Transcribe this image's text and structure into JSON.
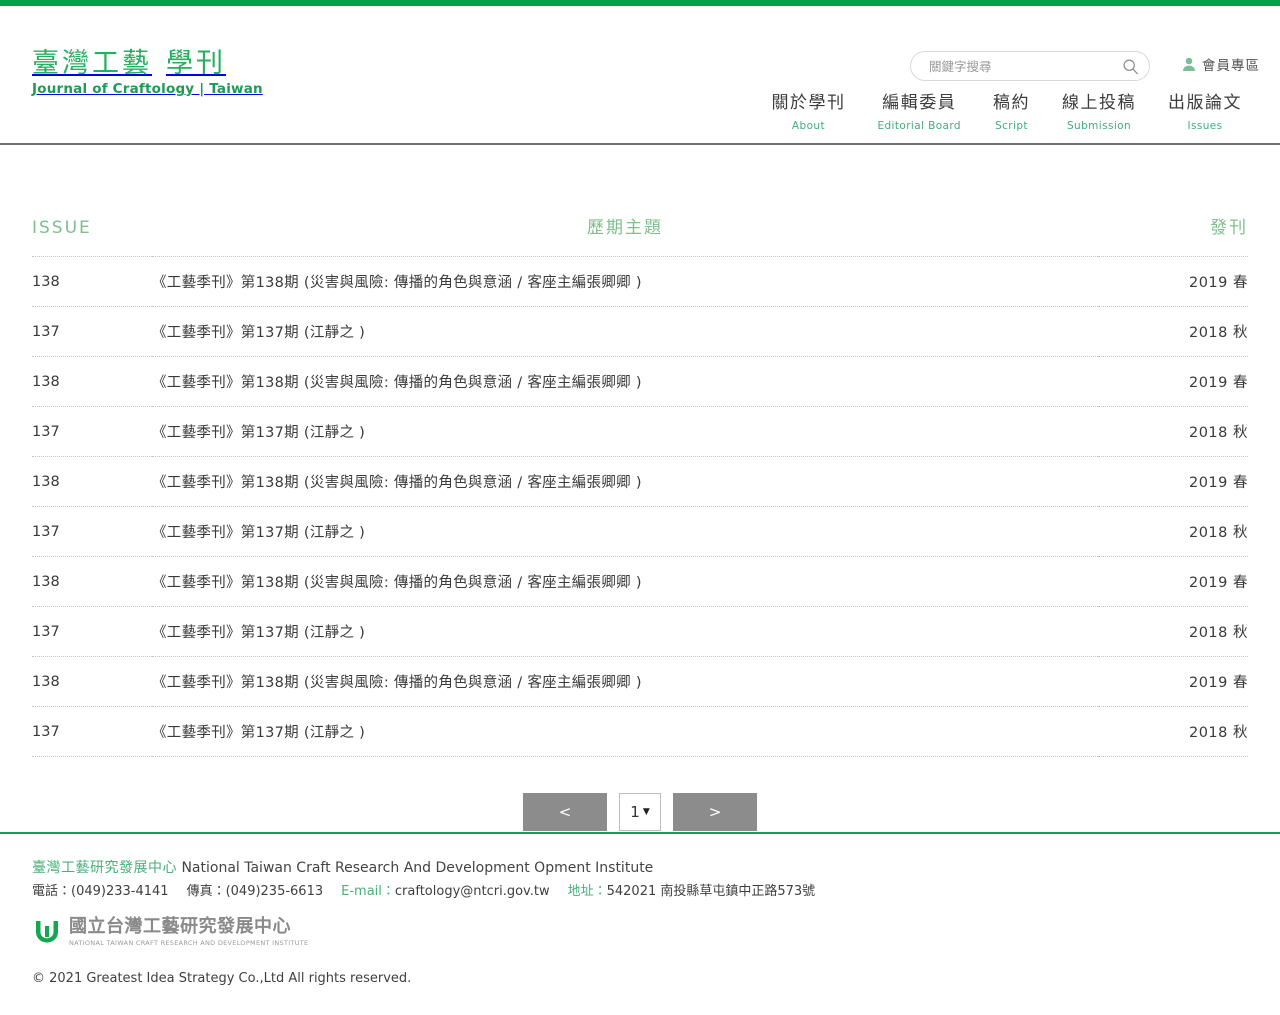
{
  "brand": {
    "logo_cn_part1": "臺灣工藝",
    "logo_cn_part2": "學刊",
    "logo_en": "Journal of Craftology  |  Taiwan",
    "accent_green": "#00a14b",
    "logo_green": "#27ae60"
  },
  "header": {
    "search": {
      "placeholder": "關鍵字搜尋",
      "value": "",
      "icon": "search-icon"
    },
    "member": {
      "label": "會員專區",
      "icon": "user-icon"
    },
    "nav": [
      {
        "cn": "關於學刊",
        "en": "About"
      },
      {
        "cn": "編輯委員",
        "en": "Editorial Board"
      },
      {
        "cn": "稿約",
        "en": "Script"
      },
      {
        "cn": "線上投稿",
        "en": "Submission"
      },
      {
        "cn": "出版論文",
        "en": "Issues"
      }
    ]
  },
  "table": {
    "columns": [
      "ISSUE",
      "歷期主題",
      "發刊"
    ],
    "rows": [
      {
        "issue": "138",
        "topic": "《工藝季刊》第138期 (災害與風險: 傳播的角色與意涵 / 客座主編張卿卿 )",
        "date": "2019 春"
      },
      {
        "issue": "137",
        "topic": "《工藝季刊》第137期 (江靜之 )",
        "date": "2018 秋"
      },
      {
        "issue": "138",
        "topic": "《工藝季刊》第138期 (災害與風險: 傳播的角色與意涵 / 客座主編張卿卿 )",
        "date": "2019 春"
      },
      {
        "issue": "137",
        "topic": "《工藝季刊》第137期 (江靜之 )",
        "date": "2018 秋"
      },
      {
        "issue": "138",
        "topic": "《工藝季刊》第138期 (災害與風險: 傳播的角色與意涵 / 客座主編張卿卿 )",
        "date": "2019 春"
      },
      {
        "issue": "137",
        "topic": "《工藝季刊》第137期 (江靜之 )",
        "date": "2018 秋"
      },
      {
        "issue": "138",
        "topic": "《工藝季刊》第138期 (災害與風險: 傳播的角色與意涵 / 客座主編張卿卿 )",
        "date": "2019 春"
      },
      {
        "issue": "137",
        "topic": "《工藝季刊》第137期 (江靜之 )",
        "date": "2018 秋"
      },
      {
        "issue": "138",
        "topic": "《工藝季刊》第138期 (災害與風險: 傳播的角色與意涵 / 客座主編張卿卿 )",
        "date": "2019 春"
      },
      {
        "issue": "137",
        "topic": "《工藝季刊》第137期 (江靜之 )",
        "date": "2018 秋"
      }
    ]
  },
  "pagination": {
    "prev_label": "<",
    "next_label": ">",
    "current_page": "1",
    "caret": "▼"
  },
  "footer": {
    "org_cn": "臺灣工藝研究發展中心",
    "org_en": "National Taiwan Craft Research And Development Opment Institute",
    "phone_label": "電話：",
    "phone_value": "(049)233-4141",
    "fax_label": "傳真：",
    "fax_value": "(049)235-6613",
    "email_label": "E-mail：",
    "email_value": "craftology@ntcri.gov.tw",
    "address_label": "地址：",
    "address_value": "542021 南投縣草屯鎮中正路573號",
    "logo_cn": "國立台灣工藝研究發展中心",
    "logo_en": "NATIONAL TAIWAN CRAFT RESEARCH AND DEVELOPMENT INSTITUTE",
    "copyright": "© 2021 Greatest Idea Strategy Co.,Ltd All rights reserved."
  }
}
